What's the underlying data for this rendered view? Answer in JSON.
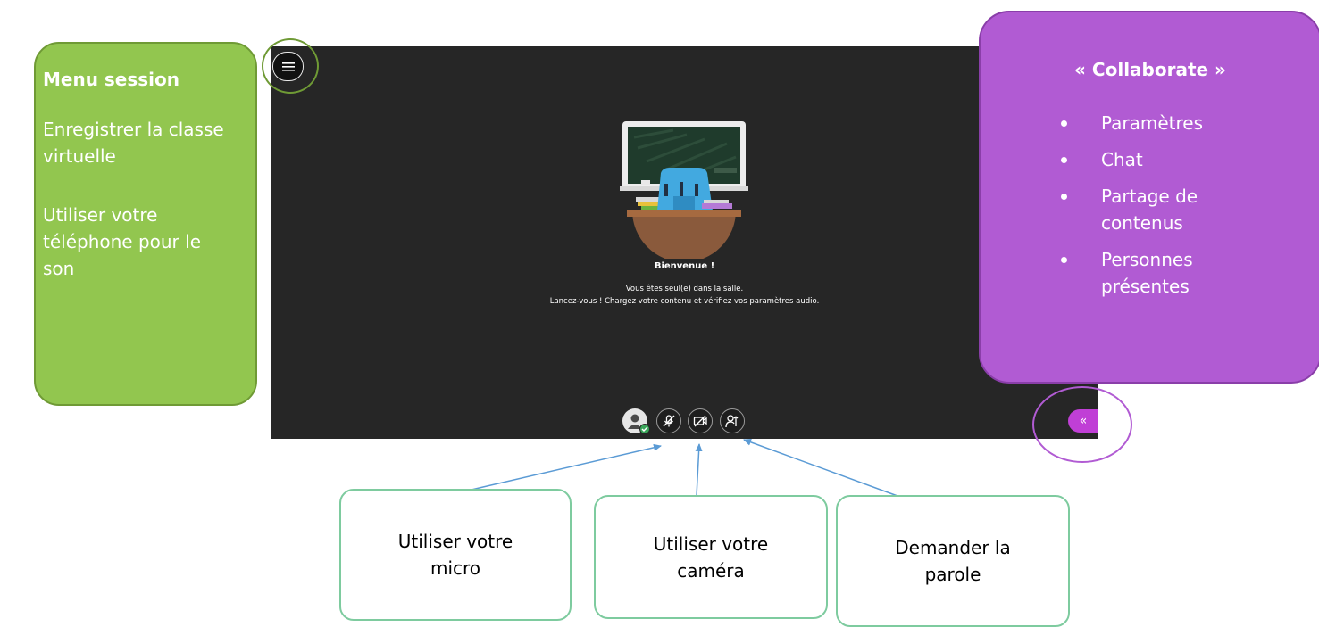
{
  "left_callout": {
    "title": "Menu session",
    "items": [
      "Enregistrer la classe virtuelle",
      "Utiliser votre téléphone pour le son"
    ]
  },
  "right_callout": {
    "title": "« Collaborate »",
    "items": [
      "Paramètres",
      "Chat",
      "Partage de contenus",
      "Personnes présentes"
    ]
  },
  "session": {
    "welcome_title": "Bienvenue !",
    "welcome_line1": "Vous êtes seul(e) dans la salle.",
    "welcome_line2": "Lancez-vous ! Chargez votre contenu et vérifiez vos paramètres audio.",
    "collapse_glyph": "«"
  },
  "bottom_callouts": [
    "Utiliser votre micro",
    "Utiliser votre caméra",
    "Demander la parole"
  ],
  "icons": [
    "menu-icon",
    "avatar-icon",
    "check-icon",
    "mic-muted-icon",
    "camera-off-icon",
    "raise-hand-icon",
    "chevron-double-left-icon"
  ],
  "colors": {
    "green_callout": "#92c64f",
    "purple_callout": "#b15bd3",
    "session_background": "#262626",
    "collaborate_toggle": "#c03fd6",
    "callout_border": "#7ecb9f",
    "arrow": "#5b9bd5"
  }
}
